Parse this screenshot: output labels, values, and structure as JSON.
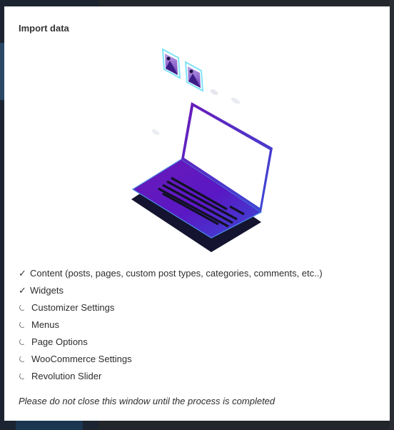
{
  "dialog": {
    "title": "Import data",
    "steps": [
      {
        "label": "Content (posts, pages, custom post types, categories, comments, etc..)",
        "status": "done"
      },
      {
        "label": "Widgets",
        "status": "done"
      },
      {
        "label": "Customizer Settings",
        "status": "loading"
      },
      {
        "label": "Menus",
        "status": "loading"
      },
      {
        "label": "Page Options",
        "status": "loading"
      },
      {
        "label": "WooCommerce Settings",
        "status": "loading"
      },
      {
        "label": "Revolution Slider",
        "status": "loading"
      }
    ],
    "notice": "Please do not close this window until the process is completed"
  },
  "icons": {
    "done": "checkmark-icon",
    "loading": "spinner-icon"
  },
  "colors": {
    "laptop_gradient_start": "#5b16b5",
    "laptop_gradient_end": "#3b3fd4",
    "laptop_shadow": "#161535",
    "image_frame": "#7fe3f7"
  }
}
